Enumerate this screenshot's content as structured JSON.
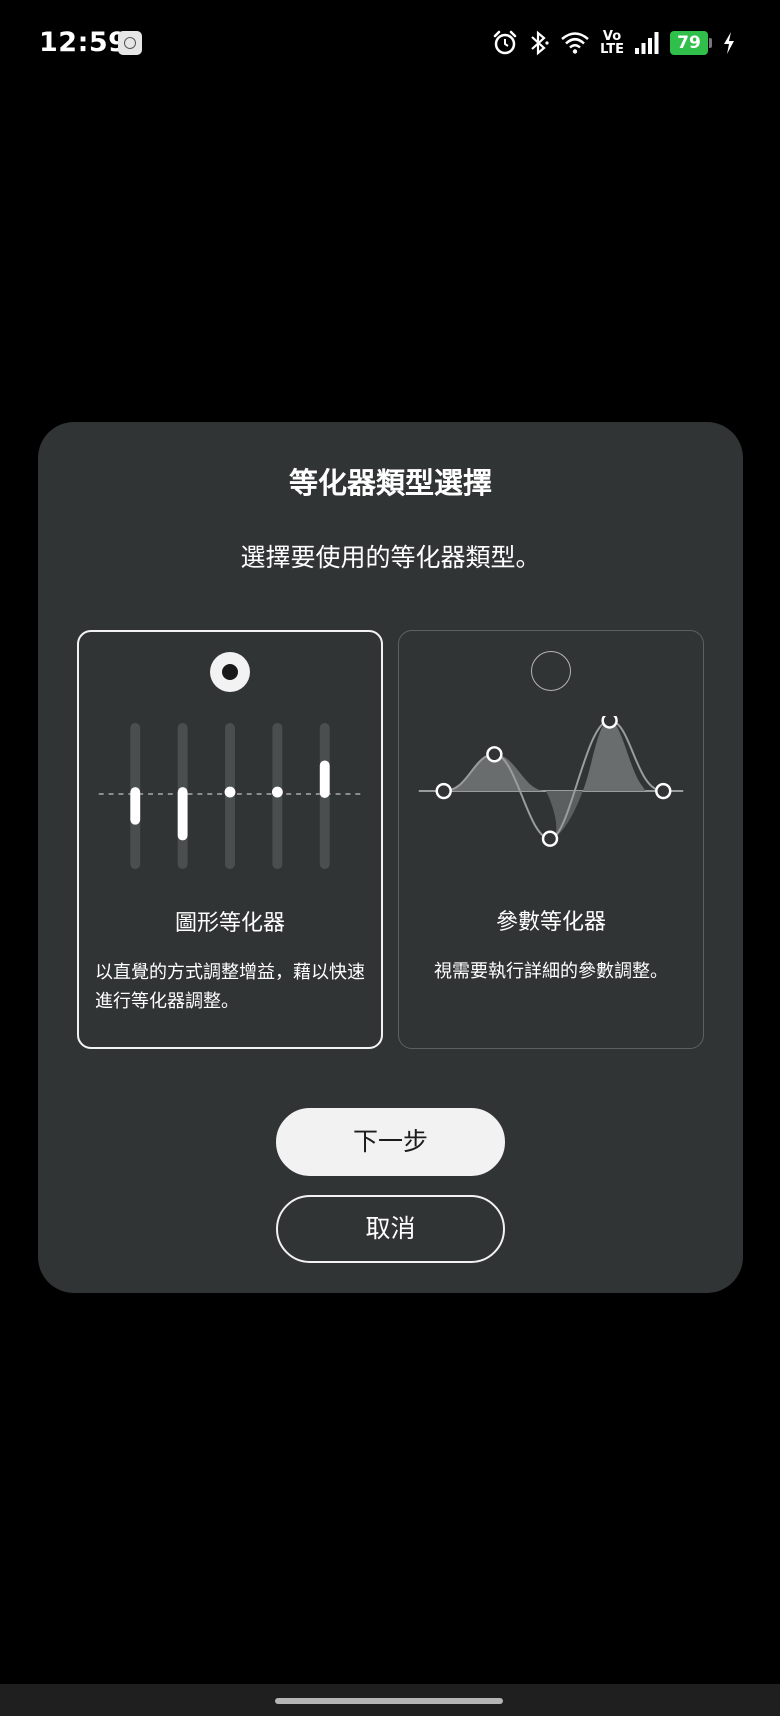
{
  "status_bar": {
    "time": "12:59",
    "battery_level": "79",
    "network_label_top": "Vo",
    "network_label_bottom": "LTE",
    "icons": [
      "app-notification-icon",
      "alarm-icon",
      "bluetooth-icon",
      "wifi-icon",
      "volte-icon",
      "signal-icon",
      "battery-icon",
      "charging-icon"
    ]
  },
  "dialog": {
    "title": "等化器類型選擇",
    "subtitle": "選擇要使用的等化器類型。",
    "options": [
      {
        "name": "圖形等化器",
        "description": "以直覺的方式調整增益，藉以快速進行等化器調整。",
        "selected": true,
        "illustration": "graphic-eq-sliders-icon"
      },
      {
        "name": "參數等化器",
        "description": "視需要執行詳細的參數調整。",
        "selected": false,
        "illustration": "parametric-eq-curve-icon"
      }
    ],
    "next_label": "下一步",
    "cancel_label": "取消"
  },
  "colors": {
    "background": "#000000",
    "dialog_background": "#313435",
    "accent_light": "#f2f2f2",
    "battery_green": "#2fbf4a"
  }
}
